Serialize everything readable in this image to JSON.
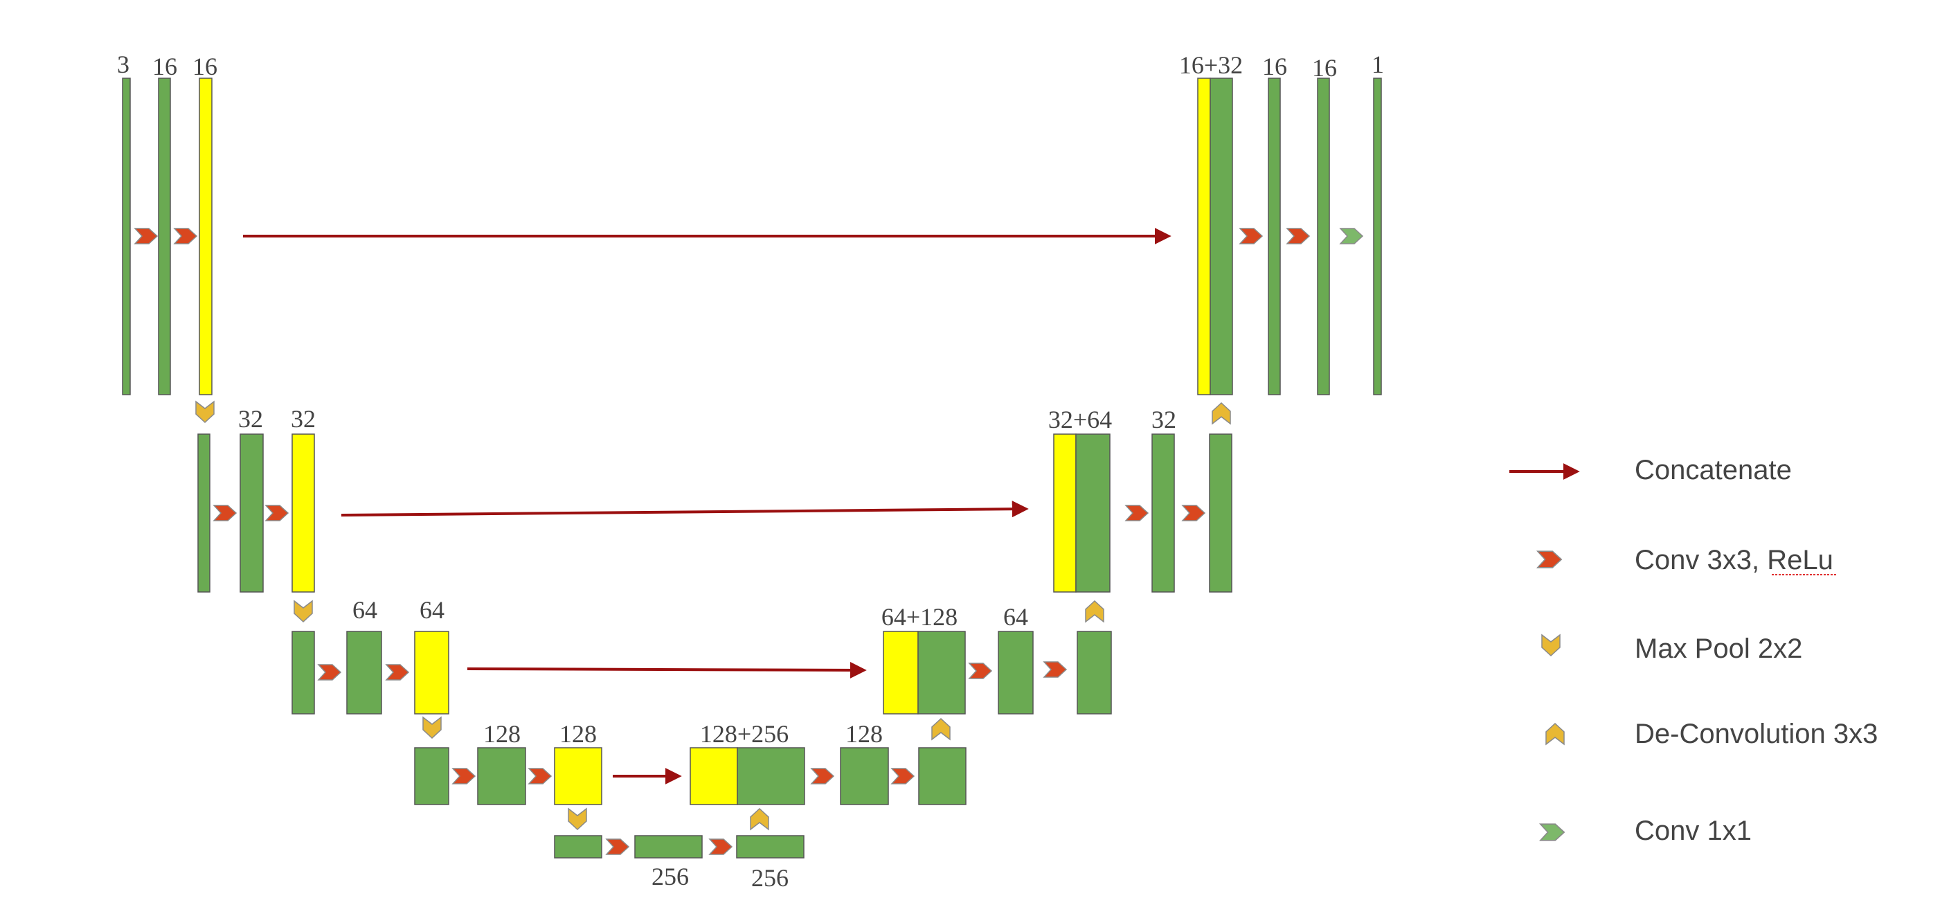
{
  "colors": {
    "feature_map": "#6aaa52",
    "concat_map": "#ffff00",
    "concat_arrow": "#9b1010",
    "conv3x3": "#d9471f",
    "maxpool": "#e8b833",
    "deconv": "#e8b833",
    "conv1x1": "#7db86a"
  },
  "labels": {
    "l1_in": "3",
    "l1_a": "16",
    "l1_b": "16",
    "l2_a": "32",
    "l2_b": "32",
    "l3_a": "64",
    "l3_b": "64",
    "l4_a": "128",
    "l4_b": "128",
    "bottleneck_a": "256",
    "bottleneck_b": "256",
    "u4_cat": "128+256",
    "u4_a": "128",
    "u3_cat": "64+128",
    "u3_a": "64",
    "u2_cat": "32+64",
    "u2_a": "32",
    "u1_cat": "16+32",
    "u1_a": "16",
    "u1_b": "16",
    "u1_out": "1"
  },
  "legend": [
    {
      "icon": "concatenate-arrow",
      "label": "Concatenate"
    },
    {
      "icon": "conv3x3-chevron",
      "label": "Conv 3x3, ReLu"
    },
    {
      "icon": "maxpool-chevron-down",
      "label": "Max Pool 2x2"
    },
    {
      "icon": "deconv-chevron-up",
      "label": "De-Convolution 3x3"
    },
    {
      "icon": "conv1x1-chevron",
      "label": "Conv 1x1"
    }
  ]
}
